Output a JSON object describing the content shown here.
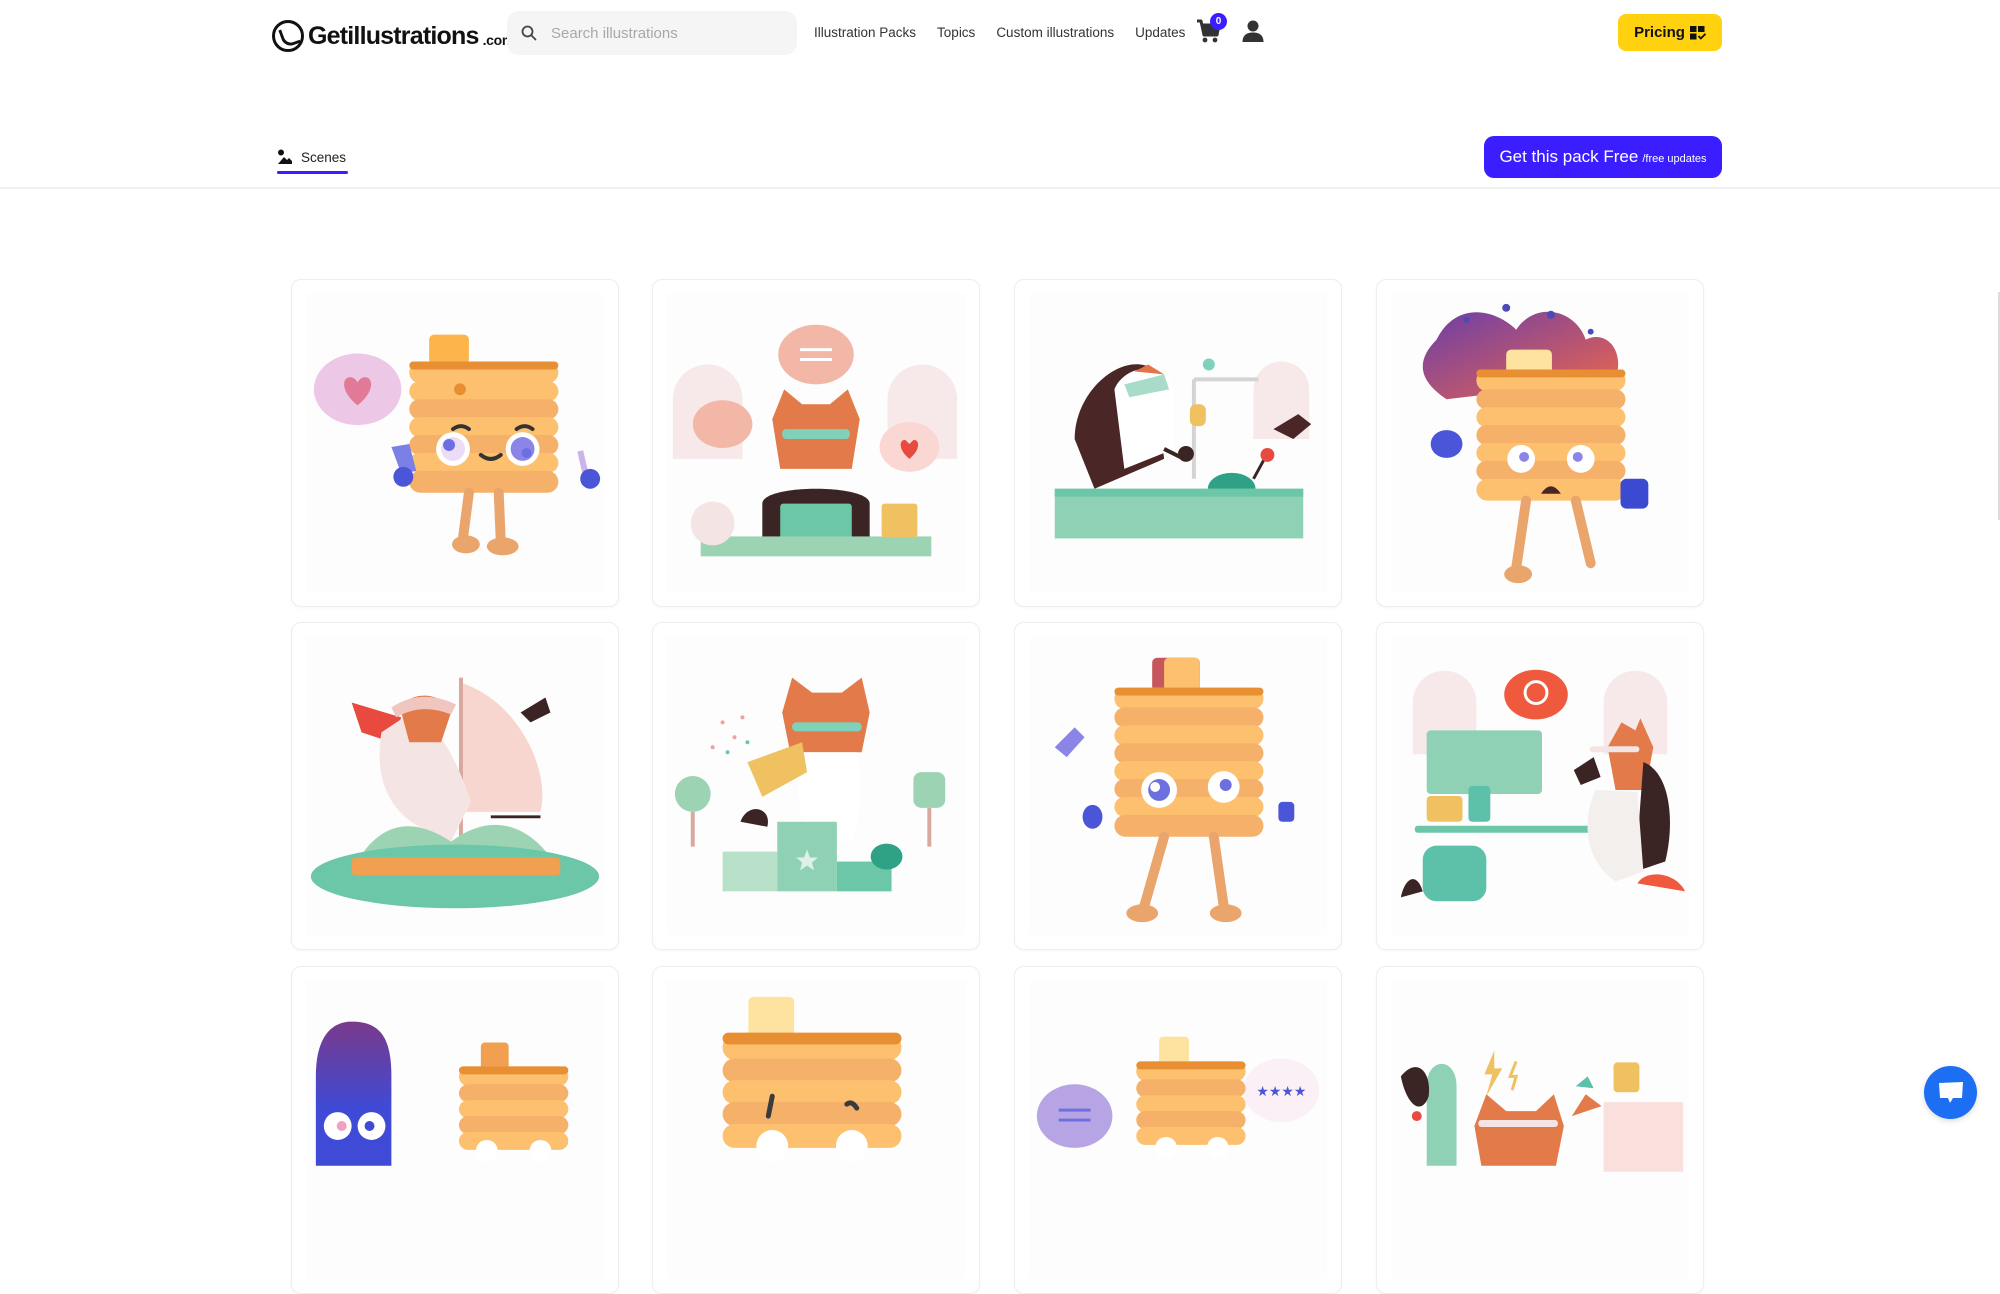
{
  "header": {
    "logo_text": "Getillustrations",
    "logo_tld": ".com",
    "search": {
      "placeholder": "Search illustrations",
      "value": ""
    },
    "nav": [
      {
        "label": "Illustration Packs"
      },
      {
        "label": "Topics"
      },
      {
        "label": "Custom illustrations"
      },
      {
        "label": "Updates"
      }
    ],
    "cart": {
      "icon": "cart-icon",
      "count": "0"
    },
    "user_icon": "user-icon",
    "pricing": {
      "label": "Pricing",
      "icon": "pricing-grid-check-icon"
    }
  },
  "subbar": {
    "tab": {
      "label": "Scenes",
      "icon": "scenes-image-icon",
      "active": true
    },
    "cta": {
      "label": "Get this pack Free",
      "sublabel": "/free updates"
    }
  },
  "colors": {
    "accent": "#3a1eff",
    "pricing_bg": "#ffd10f",
    "chat_button": "#1c6ef2",
    "divider": "#eef0f2"
  },
  "gallery": {
    "cards": [
      {
        "subject": "pancake-peace-sign-heart"
      },
      {
        "subject": "fox-laptop-chat-bubbles"
      },
      {
        "subject": "raccoon-vr-machine"
      },
      {
        "subject": "pancake-on-fire"
      },
      {
        "subject": "fox-sailing-raft-flag"
      },
      {
        "subject": "fox-trophy-podium"
      },
      {
        "subject": "pancake-worried-walking"
      },
      {
        "subject": "fox-computer-desk-bird"
      },
      {
        "subject": "pancake-with-blue-popsicle"
      },
      {
        "subject": "pancake-closeup"
      },
      {
        "subject": "pancake-chat-rating"
      },
      {
        "subject": "fox-lightning-plant"
      }
    ]
  },
  "chat_widget": {
    "icon": "chat-bubble-icon"
  }
}
